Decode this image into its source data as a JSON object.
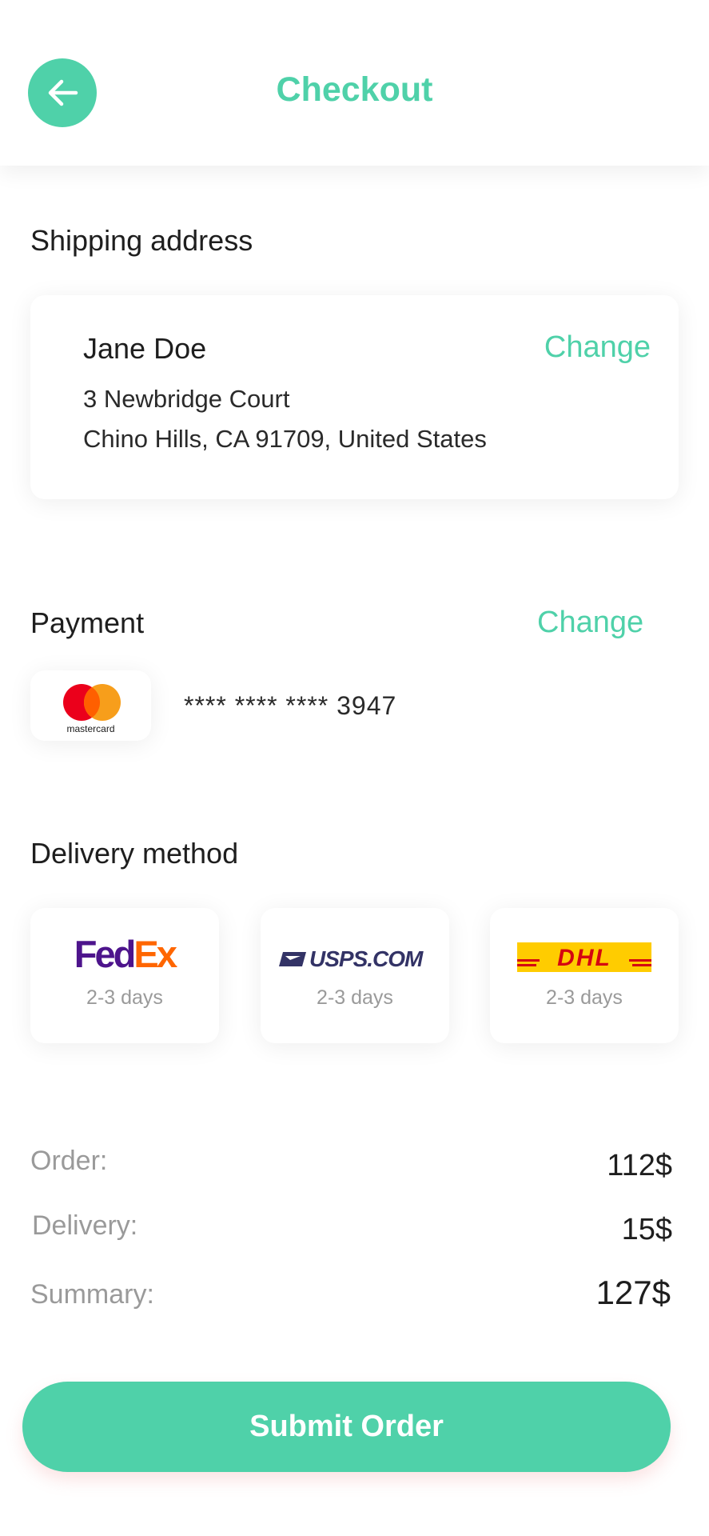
{
  "header": {
    "title": "Checkout",
    "back_icon": "arrow-left-icon"
  },
  "shipping": {
    "section_title": "Shipping address",
    "name": "Jane Doe",
    "change_label": "Change",
    "address_line1": "3 Newbridge Court",
    "address_line2": "Chino Hills, CA 91709, United States"
  },
  "payment": {
    "section_title": "Payment",
    "change_label": "Change",
    "card_brand_text": "mastercard",
    "card_number": "**** **** **** 3947"
  },
  "delivery": {
    "section_title": "Delivery method",
    "options": [
      {
        "carrier": "FedEx",
        "days": "2-3 days"
      },
      {
        "carrier": "USPS.COM",
        "days": "2-3 days"
      },
      {
        "carrier": "DHL",
        "days": "2-3 days"
      }
    ]
  },
  "summary": {
    "order_label": "Order:",
    "order_value": "112$",
    "delivery_label": "Delivery:",
    "delivery_value": "15$",
    "summary_label": "Summary:",
    "summary_value": "127$"
  },
  "submit_label": "Submit Order",
  "colors": {
    "accent": "#4FD1A9",
    "muted_text": "#9A9A9A",
    "fedex_purple": "#4D148C",
    "fedex_orange": "#FF6600",
    "dhl_yellow": "#FFCC00",
    "dhl_red": "#D40511",
    "usps_blue": "#333366"
  }
}
